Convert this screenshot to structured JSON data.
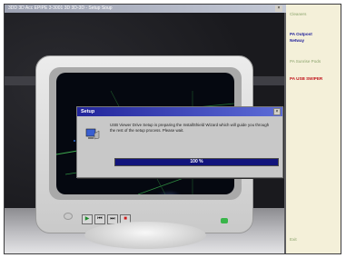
{
  "window": {
    "title": "3DD 3D Acc EPIPE 3-3001 3D 3D-3D - Setup Soup",
    "close_glyph": "×"
  },
  "sidebar": {
    "items": [
      {
        "label": "Cleaners",
        "color": "#8aa36b"
      },
      {
        "label": "PA Outpost",
        "color": "#1d1d9a"
      },
      {
        "label": "Netway",
        "color": "#1d1d9a"
      },
      {
        "label": "PA Sunrise Pods",
        "color": "#8aa36b"
      },
      {
        "label": "PA USB SWIPER",
        "color": "#c0121b"
      }
    ],
    "exit_label": "Exit",
    "exit_color": "#8aa36b"
  },
  "dialog": {
    "title": "Setup",
    "close_glyph": "×",
    "message": "USB Viewer Drive Setup is preparing the InstallShield Wizard which will guide you through the rest of the setup process. Please wait.",
    "progress_text": "100 %",
    "progress_percent": 100,
    "icon": "computer-setup-icon"
  },
  "monitor": {
    "controls": [
      {
        "name": "play-icon",
        "glyph": "▶",
        "color": "#1c8a2a"
      },
      {
        "name": "prev-icon",
        "glyph": "⏮",
        "color": "#222222"
      },
      {
        "name": "next-icon",
        "glyph": "⏭",
        "color": "#222222"
      },
      {
        "name": "stop-icon",
        "glyph": "■",
        "color": "#d01818"
      }
    ],
    "power_led": "power-led-icon"
  }
}
